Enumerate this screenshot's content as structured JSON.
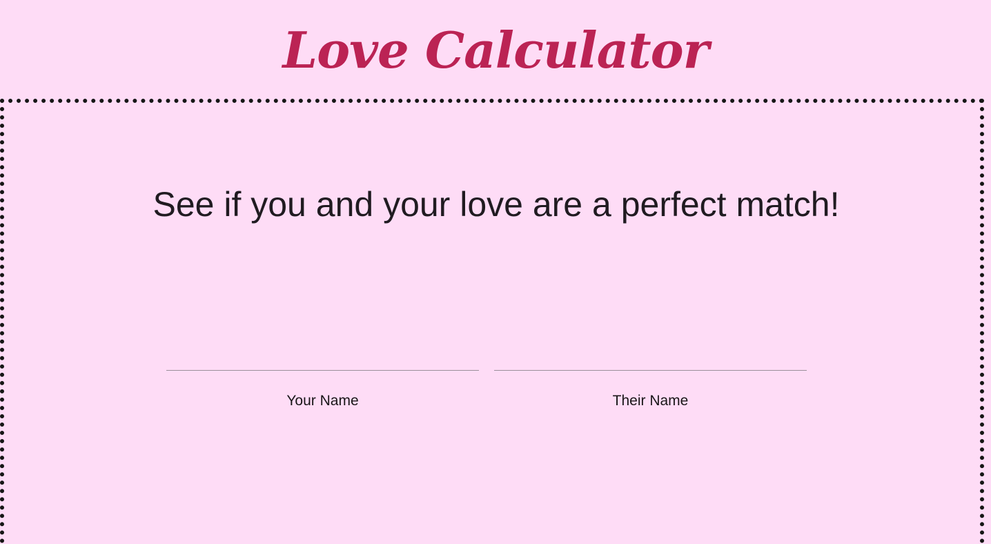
{
  "header": {
    "title": "Love Calculator"
  },
  "main": {
    "tagline": "See if you and your love are a perfect match!",
    "fields": [
      {
        "label": "Your Name",
        "value": "",
        "placeholder": ""
      },
      {
        "label": "Their Name",
        "value": "",
        "placeholder": ""
      }
    ]
  },
  "colors": {
    "background": "#fedcf6",
    "title": "#bb2354",
    "border": "#161616",
    "text": "#1e1a1f"
  }
}
